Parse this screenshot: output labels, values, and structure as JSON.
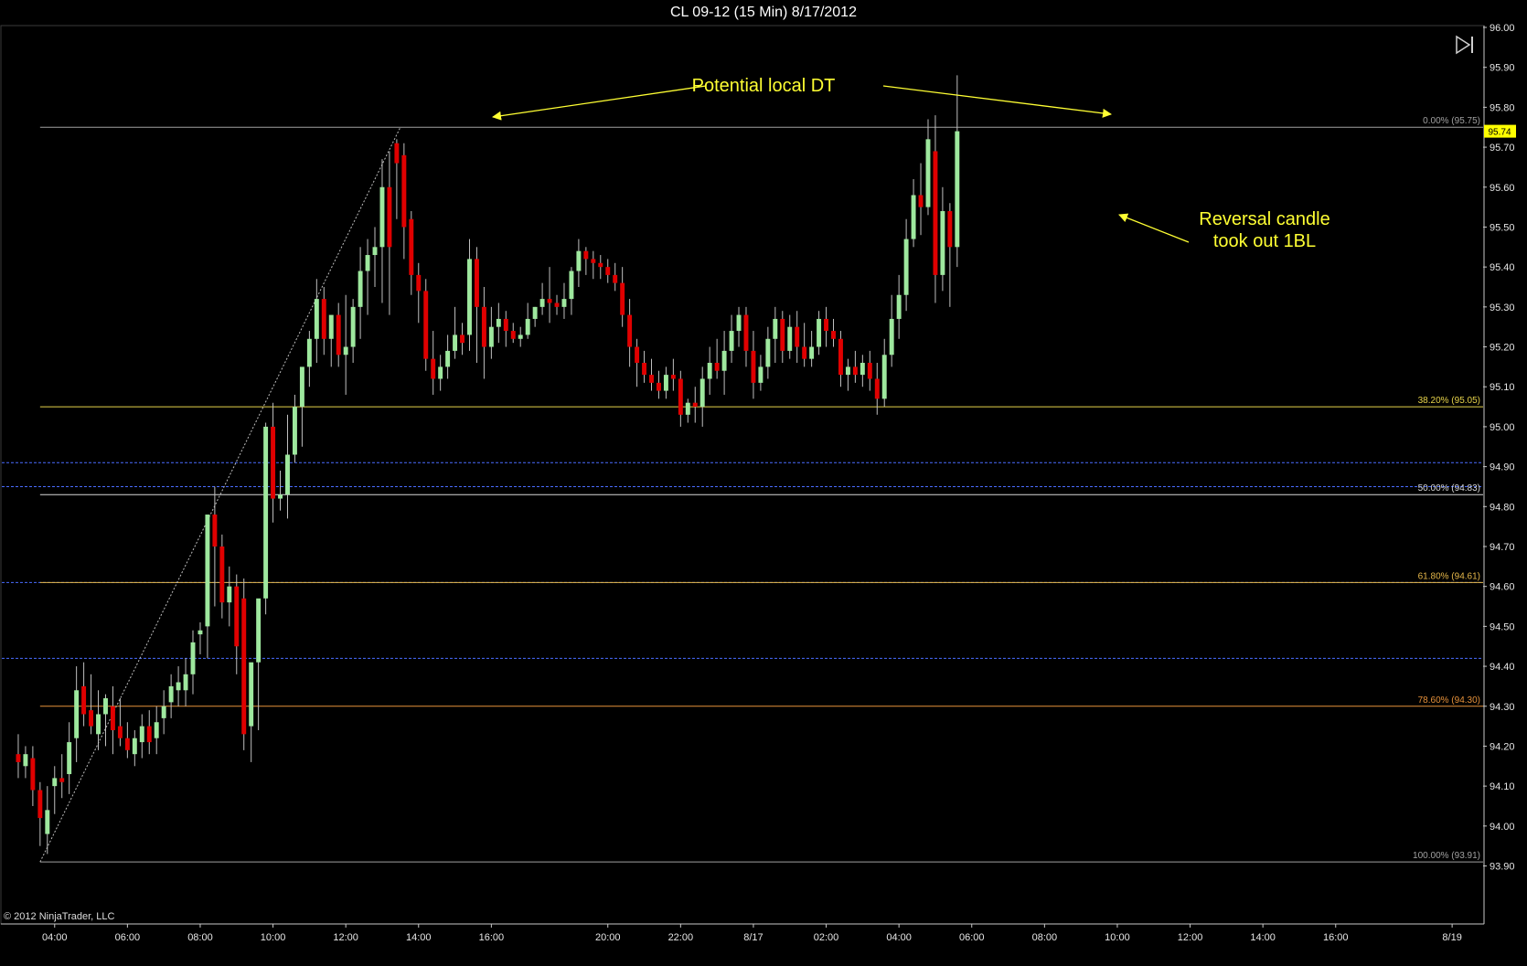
{
  "window": {
    "title": "CL 09-12 (15 Min)  8/17/2012",
    "copyright": "© 2012 NinjaTrader, LLC"
  },
  "colors": {
    "background": "#000000",
    "up_candle": "#9ee89e",
    "down_candle": "#e00000",
    "axis": "#c8c8c8",
    "annotation": "#ffff33",
    "fib_0": "#a0a0a0",
    "fib_382": "#e6d24a",
    "fib_50": "#d8d8d8",
    "fib_618": "#e6b84a",
    "fib_786": "#e6913a",
    "fib_100": "#a0a0a0",
    "blue_dashed": "#4a6cff"
  },
  "chart_data": {
    "type": "candlestick",
    "title": "CL 09-12 (15 Min)  8/17/2012",
    "ylim": [
      93.86,
      96.0
    ],
    "y_ticks": [
      "96.00",
      "95.90",
      "95.80",
      "95.70",
      "95.60",
      "95.50",
      "95.40",
      "95.30",
      "95.20",
      "95.10",
      "95.00",
      "94.90",
      "94.80",
      "94.70",
      "94.60",
      "94.50",
      "94.40",
      "94.30",
      "94.20",
      "94.10",
      "94.00",
      "93.90"
    ],
    "x_ticks": [
      {
        "label": "04:00",
        "bar": 5
      },
      {
        "label": "06:00",
        "bar": 15
      },
      {
        "label": "08:00",
        "bar": 25
      },
      {
        "label": "10:00",
        "bar": 35
      },
      {
        "label": "12:00",
        "bar": 45
      },
      {
        "label": "14:00",
        "bar": 55
      },
      {
        "label": "16:00",
        "bar": 65
      },
      {
        "label": "20:00",
        "bar": 81
      },
      {
        "label": "22:00",
        "bar": 91
      },
      {
        "label": "8/17",
        "bar": 101
      },
      {
        "label": "02:00",
        "bar": 111
      },
      {
        "label": "04:00",
        "bar": 121
      },
      {
        "label": "06:00",
        "bar": 131
      },
      {
        "label": "08:00",
        "bar": 141
      },
      {
        "label": "10:00",
        "bar": 151
      },
      {
        "label": "12:00",
        "bar": 161
      },
      {
        "label": "14:00",
        "bar": 171
      },
      {
        "label": "16:00",
        "bar": 181
      },
      {
        "label": "8/19",
        "bar": 197
      }
    ],
    "bar_count_range": [
      -1,
      200
    ],
    "candles": [
      [
        94.18,
        94.23,
        94.12,
        94.16
      ],
      [
        94.15,
        94.2,
        94.12,
        94.18
      ],
      [
        94.17,
        94.2,
        94.05,
        94.09
      ],
      [
        94.09,
        94.11,
        93.95,
        94.02
      ],
      [
        93.98,
        94.1,
        93.93,
        94.04
      ],
      [
        94.1,
        94.15,
        94.03,
        94.12
      ],
      [
        94.12,
        94.18,
        94.07,
        94.11
      ],
      [
        94.13,
        94.26,
        94.08,
        94.21
      ],
      [
        94.22,
        94.4,
        94.16,
        94.34
      ],
      [
        94.35,
        94.41,
        94.25,
        94.28
      ],
      [
        94.29,
        94.38,
        94.23,
        94.25
      ],
      [
        94.23,
        94.34,
        94.19,
        94.28
      ],
      [
        94.28,
        94.33,
        94.2,
        94.32
      ],
      [
        94.3,
        94.35,
        94.18,
        94.24
      ],
      [
        94.25,
        94.32,
        94.2,
        94.22
      ],
      [
        94.22,
        94.26,
        94.17,
        94.19
      ],
      [
        94.18,
        94.24,
        94.15,
        94.22
      ],
      [
        94.21,
        94.28,
        94.17,
        94.25
      ],
      [
        94.25,
        94.29,
        94.18,
        94.21
      ],
      [
        94.22,
        94.3,
        94.18,
        94.26
      ],
      [
        94.27,
        94.34,
        94.23,
        94.3
      ],
      [
        94.31,
        94.38,
        94.27,
        94.35
      ],
      [
        94.34,
        94.4,
        94.3,
        94.36
      ],
      [
        94.34,
        94.42,
        94.3,
        94.38
      ],
      [
        94.38,
        94.49,
        94.33,
        94.46
      ],
      [
        94.48,
        94.51,
        94.43,
        94.49
      ],
      [
        94.5,
        94.65,
        94.42,
        94.78
      ],
      [
        94.78,
        94.85,
        94.55,
        94.7
      ],
      [
        94.7,
        94.73,
        94.52,
        94.56
      ],
      [
        94.56,
        94.65,
        94.5,
        94.6
      ],
      [
        94.6,
        94.63,
        94.38,
        94.45
      ],
      [
        94.57,
        94.62,
        94.19,
        94.23
      ],
      [
        94.25,
        94.34,
        94.16,
        94.41
      ],
      [
        94.41,
        94.46,
        94.24,
        94.57
      ],
      [
        94.57,
        95.01,
        94.53,
        95.0
      ],
      [
        95.0,
        95.06,
        94.76,
        94.82
      ],
      [
        94.82,
        94.89,
        94.79,
        94.83
      ],
      [
        94.83,
        95.03,
        94.77,
        94.93
      ],
      [
        94.93,
        95.08,
        94.91,
        95.05
      ],
      [
        95.05,
        95.1,
        94.95,
        95.15
      ],
      [
        95.15,
        95.24,
        95.1,
        95.22
      ],
      [
        95.22,
        95.37,
        95.16,
        95.32
      ],
      [
        95.32,
        95.35,
        95.18,
        95.22
      ],
      [
        95.22,
        95.27,
        95.15,
        95.28
      ],
      [
        95.28,
        95.31,
        95.15,
        95.18
      ],
      [
        95.18,
        95.33,
        95.08,
        95.2
      ],
      [
        95.2,
        95.32,
        95.16,
        95.3
      ],
      [
        95.3,
        95.45,
        95.22,
        95.39
      ],
      [
        95.39,
        95.47,
        95.28,
        95.43
      ],
      [
        95.43,
        95.5,
        95.35,
        95.45
      ],
      [
        95.45,
        95.67,
        95.31,
        95.6
      ],
      [
        95.6,
        95.69,
        95.28,
        95.45
      ],
      [
        95.71,
        95.72,
        95.52,
        95.66
      ],
      [
        95.68,
        95.71,
        95.42,
        95.5
      ],
      [
        95.52,
        95.54,
        95.33,
        95.38
      ],
      [
        95.38,
        95.41,
        95.26,
        95.34
      ],
      [
        95.34,
        95.37,
        95.14,
        95.17
      ],
      [
        95.17,
        95.24,
        95.08,
        95.12
      ],
      [
        95.12,
        95.18,
        95.09,
        95.15
      ],
      [
        95.15,
        95.23,
        95.12,
        95.19
      ],
      [
        95.19,
        95.3,
        95.17,
        95.23
      ],
      [
        95.23,
        95.26,
        95.18,
        95.21
      ],
      [
        95.23,
        95.47,
        95.19,
        95.42
      ],
      [
        95.42,
        95.45,
        95.16,
        95.3
      ],
      [
        95.3,
        95.35,
        95.12,
        95.2
      ],
      [
        95.2,
        95.3,
        95.17,
        95.25
      ],
      [
        95.25,
        95.31,
        95.21,
        95.27
      ],
      [
        95.27,
        95.29,
        95.2,
        95.24
      ],
      [
        95.24,
        95.26,
        95.21,
        95.22
      ],
      [
        95.22,
        95.25,
        95.2,
        95.23
      ],
      [
        95.23,
        95.31,
        95.22,
        95.27
      ],
      [
        95.27,
        95.3,
        95.25,
        95.3
      ],
      [
        95.3,
        95.36,
        95.28,
        95.32
      ],
      [
        95.32,
        95.4,
        95.26,
        95.31
      ],
      [
        95.31,
        95.33,
        95.28,
        95.3
      ],
      [
        95.3,
        95.36,
        95.27,
        95.32
      ],
      [
        95.32,
        95.4,
        95.28,
        95.39
      ],
      [
        95.39,
        95.47,
        95.35,
        95.44
      ],
      [
        95.44,
        95.45,
        95.38,
        95.42
      ],
      [
        95.42,
        95.44,
        95.37,
        95.41
      ],
      [
        95.41,
        95.43,
        95.37,
        95.4
      ],
      [
        95.4,
        95.42,
        95.36,
        95.38
      ],
      [
        95.38,
        95.41,
        95.34,
        95.36
      ],
      [
        95.36,
        95.4,
        95.25,
        95.28
      ],
      [
        95.28,
        95.32,
        95.15,
        95.2
      ],
      [
        95.2,
        95.22,
        95.1,
        95.16
      ],
      [
        95.16,
        95.19,
        95.11,
        95.13
      ],
      [
        95.13,
        95.17,
        95.09,
        95.11
      ],
      [
        95.11,
        95.14,
        95.07,
        95.09
      ],
      [
        95.09,
        95.15,
        95.07,
        95.13
      ],
      [
        95.13,
        95.17,
        95.09,
        95.12
      ],
      [
        95.12,
        95.14,
        95.0,
        95.03
      ],
      [
        95.03,
        95.07,
        95.01,
        95.06
      ],
      [
        95.06,
        95.1,
        95.01,
        95.05
      ],
      [
        95.05,
        95.15,
        95.0,
        95.12
      ],
      [
        95.12,
        95.2,
        95.08,
        95.16
      ],
      [
        95.16,
        95.22,
        95.12,
        95.14
      ],
      [
        95.14,
        95.24,
        95.08,
        95.19
      ],
      [
        95.19,
        95.28,
        95.16,
        95.24
      ],
      [
        95.24,
        95.3,
        95.2,
        95.28
      ],
      [
        95.28,
        95.3,
        95.15,
        95.19
      ],
      [
        95.19,
        95.24,
        95.07,
        95.11
      ],
      [
        95.11,
        95.18,
        95.09,
        95.15
      ],
      [
        95.15,
        95.25,
        95.12,
        95.22
      ],
      [
        95.22,
        95.3,
        95.16,
        95.27
      ],
      [
        95.27,
        95.29,
        95.16,
        95.19
      ],
      [
        95.19,
        95.28,
        95.17,
        95.25
      ],
      [
        95.25,
        95.29,
        95.16,
        95.2
      ],
      [
        95.2,
        95.26,
        95.15,
        95.17
      ],
      [
        95.17,
        95.24,
        95.15,
        95.2
      ],
      [
        95.2,
        95.29,
        95.18,
        95.27
      ],
      [
        95.27,
        95.3,
        95.2,
        95.24
      ],
      [
        95.24,
        95.27,
        95.2,
        95.22
      ],
      [
        95.22,
        95.24,
        95.1,
        95.13
      ],
      [
        95.13,
        95.17,
        95.09,
        95.15
      ],
      [
        95.15,
        95.19,
        95.11,
        95.13
      ],
      [
        95.13,
        95.18,
        95.1,
        95.16
      ],
      [
        95.16,
        95.19,
        95.09,
        95.12
      ],
      [
        95.12,
        95.16,
        95.03,
        95.07
      ],
      [
        95.07,
        95.22,
        95.05,
        95.18
      ],
      [
        95.18,
        95.33,
        95.15,
        95.27
      ],
      [
        95.27,
        95.38,
        95.22,
        95.33
      ],
      [
        95.33,
        95.52,
        95.29,
        95.47
      ],
      [
        95.47,
        95.62,
        95.45,
        95.58
      ],
      [
        95.58,
        95.66,
        95.48,
        95.55
      ],
      [
        95.55,
        95.77,
        95.53,
        95.72
      ],
      [
        95.69,
        95.78,
        95.31,
        95.38
      ],
      [
        95.38,
        95.6,
        95.34,
        95.54
      ],
      [
        95.54,
        95.56,
        95.3,
        95.45
      ],
      [
        95.45,
        95.88,
        95.4,
        95.74
      ]
    ],
    "fib_levels": [
      {
        "label": "0.00% (95.75)",
        "value": 95.75
      },
      {
        "label": "38.20% (95.05)",
        "value": 95.05
      },
      {
        "label": "50.00% (94.83)",
        "value": 94.83
      },
      {
        "label": "61.80% (94.61)",
        "value": 94.61
      },
      {
        "label": "78.60% (94.30)",
        "value": 94.3
      },
      {
        "label": "100.00% (93.91)",
        "value": 93.91
      }
    ],
    "blue_dashed_levels": [
      94.91,
      94.85,
      94.61,
      94.42
    ],
    "current_price": "95.74",
    "annotations": [
      {
        "text": "Potential local DT"
      },
      {
        "text": "Reversal candle"
      },
      {
        "text": "took out 1BL"
      }
    ]
  }
}
